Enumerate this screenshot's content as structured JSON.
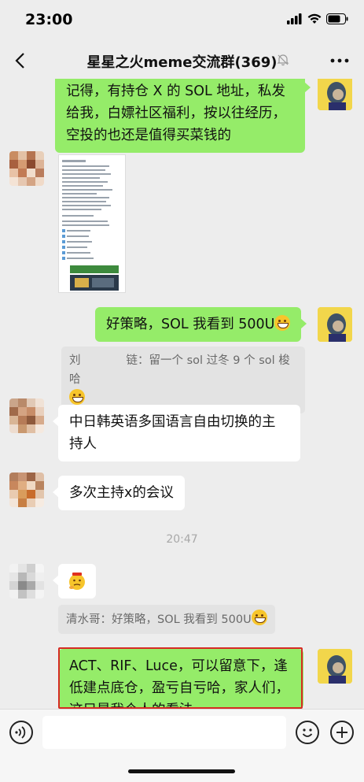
{
  "status": {
    "time": "23:00"
  },
  "header": {
    "title": "星星之火meme交流群(369)"
  },
  "messages": {
    "m1": {
      "lines": [
        "记得，有持仓 X 的 SOL 地址，私发",
        "给我，白嫖社区福利，按以往经历，",
        "空投的也还是值得买菜钱的"
      ]
    },
    "m3": {
      "text": "好策略，SOL 我看到 500U"
    },
    "q1": {
      "line1": "刘　　　　链：留一个 sol 过冬 9 个 sol 梭哈"
    },
    "m4": {
      "lines": [
        "中日韩英语多国语言自由切换的主",
        "持人"
      ]
    },
    "m5": {
      "text": "多次主持x的会议"
    },
    "time1": "20:47",
    "q2": {
      "text": "清水哥：好策略，SOL 我看到 500U"
    },
    "m7": {
      "lines": [
        "ACT、RIF、Luce，可以留意下，逢",
        "低建点底仓，盈亏自亏哈，家人们，",
        "这只是我个人的看法"
      ]
    }
  },
  "colors": {
    "green_bubble": "#95ec69",
    "background": "#ededed",
    "highlight": "#d62b23"
  },
  "icons": [
    "back-icon",
    "mute-icon",
    "more-icon",
    "voice-icon",
    "emoji-icon",
    "plus-icon"
  ]
}
